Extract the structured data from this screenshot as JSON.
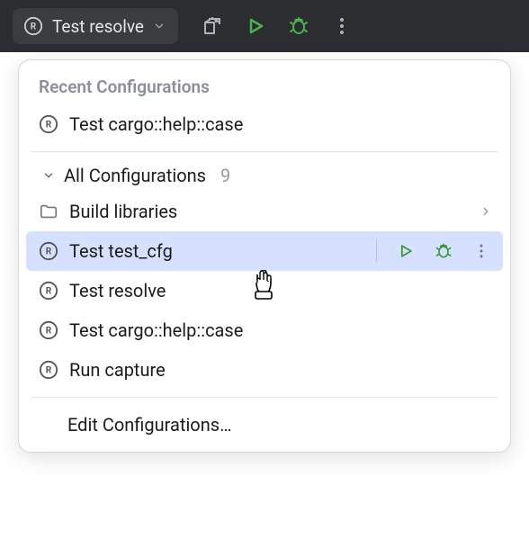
{
  "toolbar": {
    "selected_config": "Test resolve"
  },
  "popup": {
    "recent_title": "Recent Configurations",
    "recent": [
      {
        "label": "Test cargo::help::case",
        "icon": "rust"
      }
    ],
    "all_title": "All Configurations",
    "all_count": "9",
    "items": [
      {
        "label": "Build libraries",
        "icon": "folder",
        "has_children": true
      },
      {
        "label": "Test test_cfg",
        "icon": "rust",
        "hovered": true
      },
      {
        "label": "Test resolve",
        "icon": "rust"
      },
      {
        "label": "Test cargo::help::case",
        "icon": "rust"
      },
      {
        "label": "Run capture",
        "icon": "rust"
      }
    ],
    "edit_label": "Edit Configurations…"
  },
  "icons": {
    "rust": "rust-icon",
    "folder": "folder-icon",
    "build": "build-icon",
    "run": "run-icon",
    "debug": "debug-icon",
    "more": "more-icon",
    "chevron_down": "chevron-down-icon",
    "chevron_right": "chevron-right-icon"
  }
}
